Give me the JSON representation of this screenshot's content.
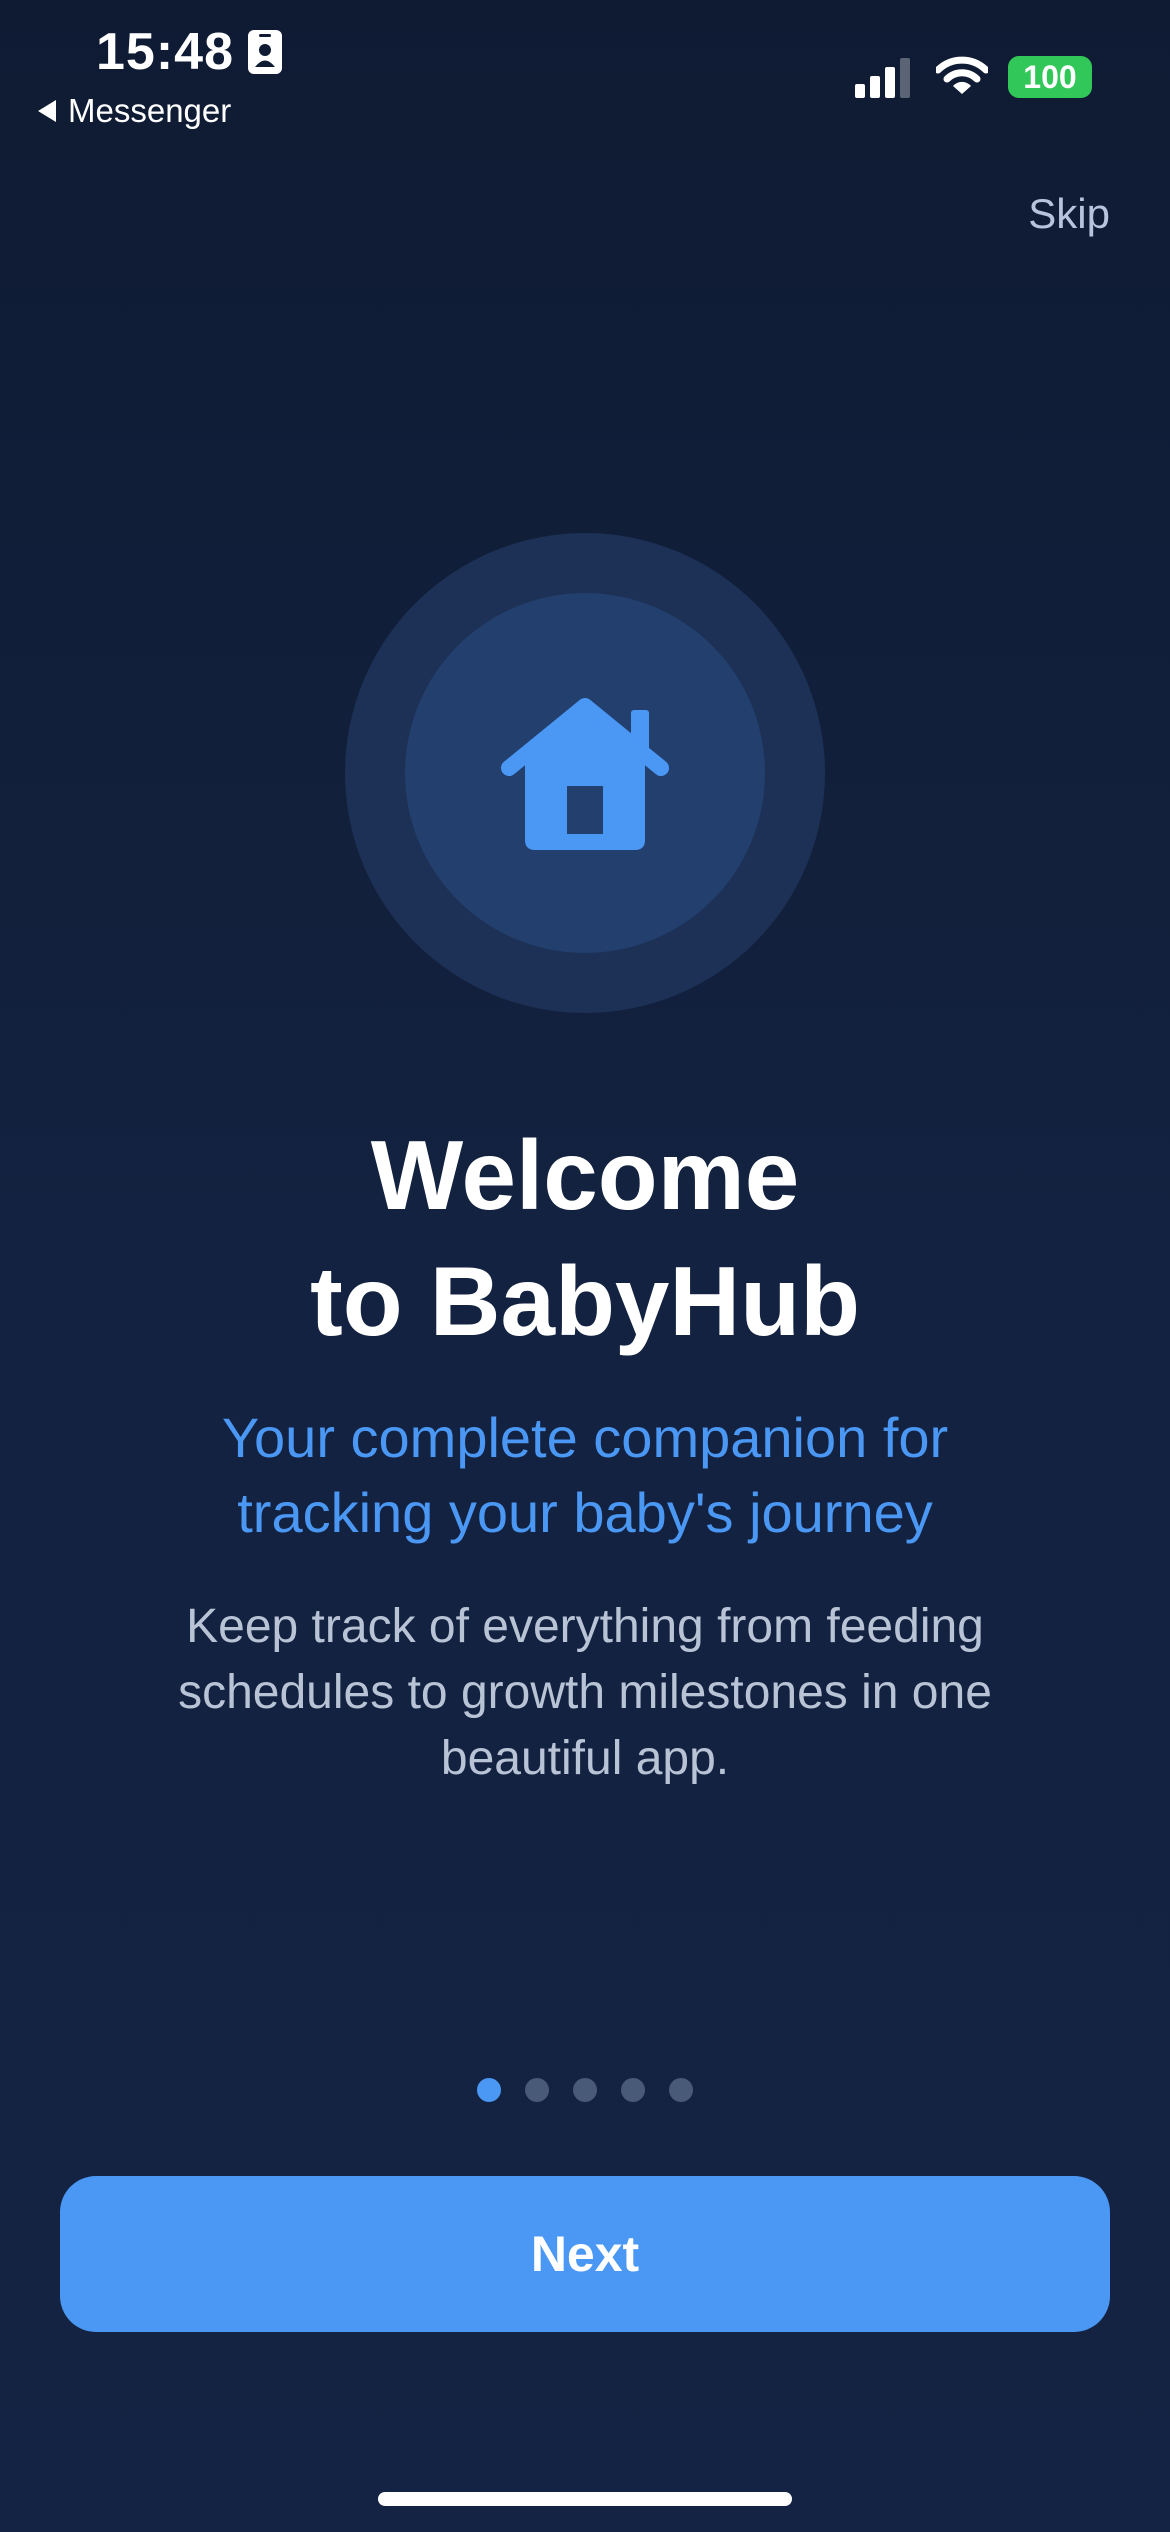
{
  "status_bar": {
    "time": "15:48",
    "back_app": "Messenger",
    "battery": "100",
    "battery_color": "#31c759"
  },
  "header": {
    "skip_label": "Skip"
  },
  "hero": {
    "icon": "house-icon",
    "accent": "#4a97f4"
  },
  "content": {
    "title_line1": "Welcome",
    "title_line2": "to BabyHub",
    "subtitle_line1": "Your complete companion for",
    "subtitle_line2": "tracking your baby's journey",
    "body_line1": "Keep track of everything from feeding",
    "body_line2": "schedules to growth milestones in one",
    "body_line3": "beautiful app."
  },
  "pagination": {
    "total": 5,
    "current": 1
  },
  "footer": {
    "next_label": "Next"
  }
}
